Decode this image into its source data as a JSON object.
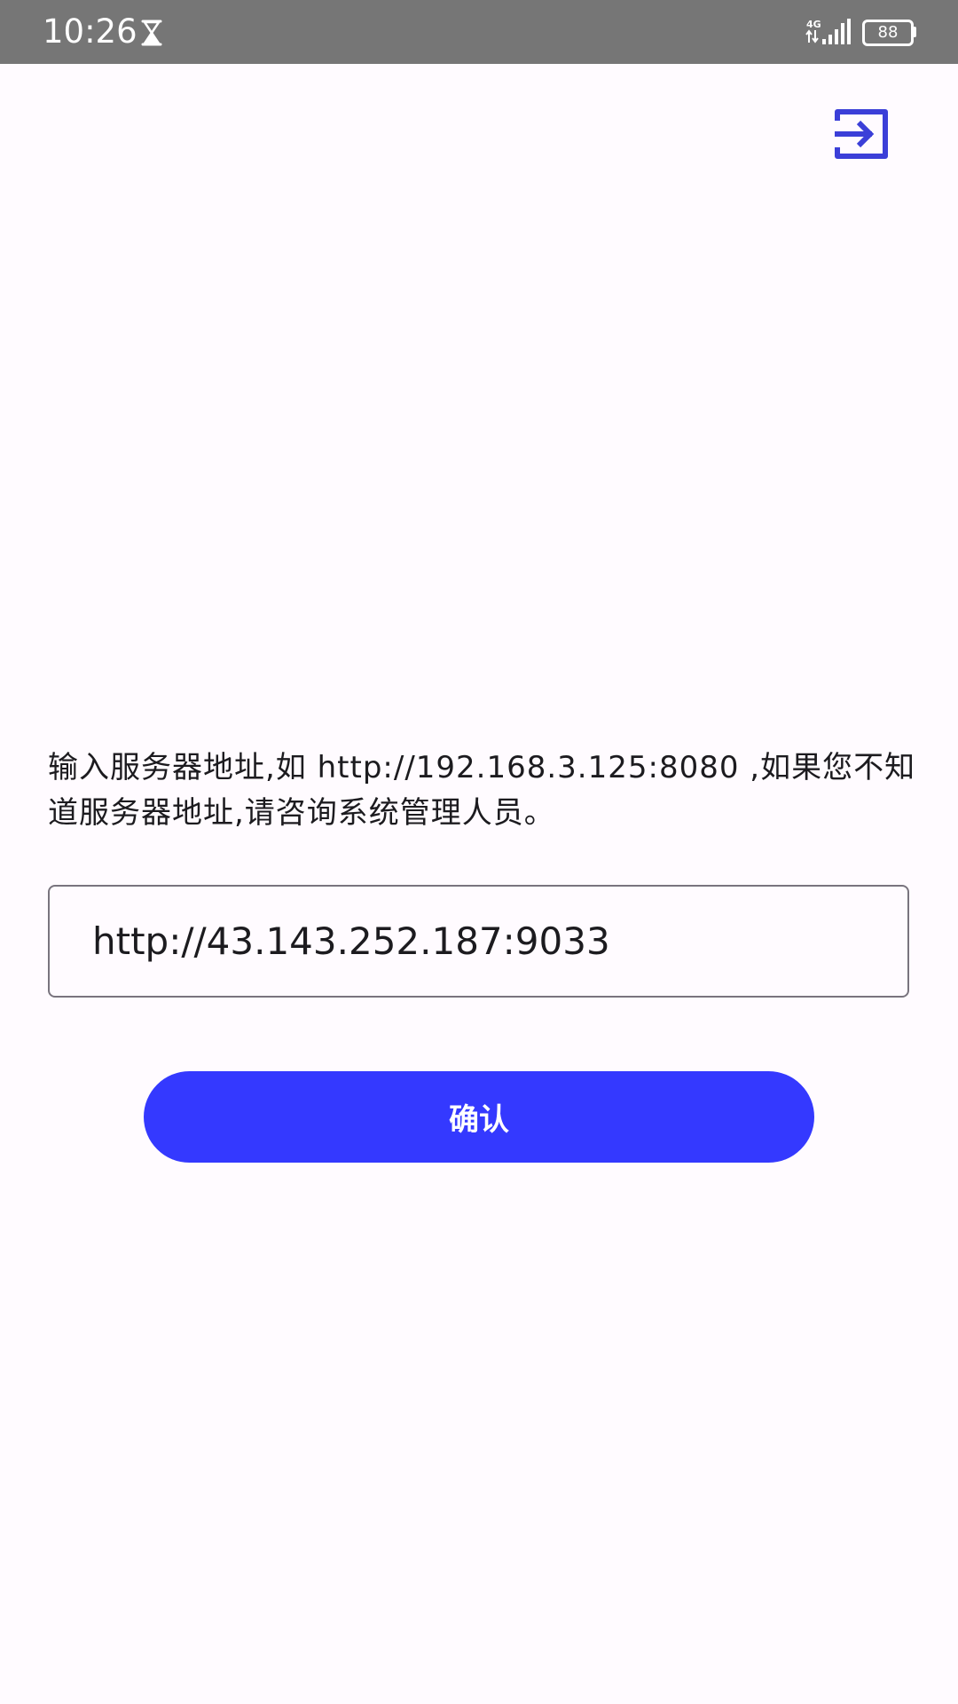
{
  "status_bar": {
    "time": "10:26",
    "network_type": "4G",
    "battery_level": "88",
    "icons": [
      "hourglass-icon",
      "signal-icon",
      "battery-icon"
    ]
  },
  "header": {
    "exit_icon": "exit-icon"
  },
  "form": {
    "instruction": "输入服务器地址,如 http://192.168.3.125:8080 ,如果您不知道服务器地址,请咨询系统管理人员。",
    "server_url_value": "http://43.143.252.187:9033",
    "confirm_label": "确认"
  },
  "colors": {
    "status_bar_bg": "#767676",
    "background": "#fffbff",
    "accent": "#3439ff",
    "exit_icon": "#3b3fd8",
    "field_border": "#79747e",
    "text": "#1c1b1f"
  }
}
